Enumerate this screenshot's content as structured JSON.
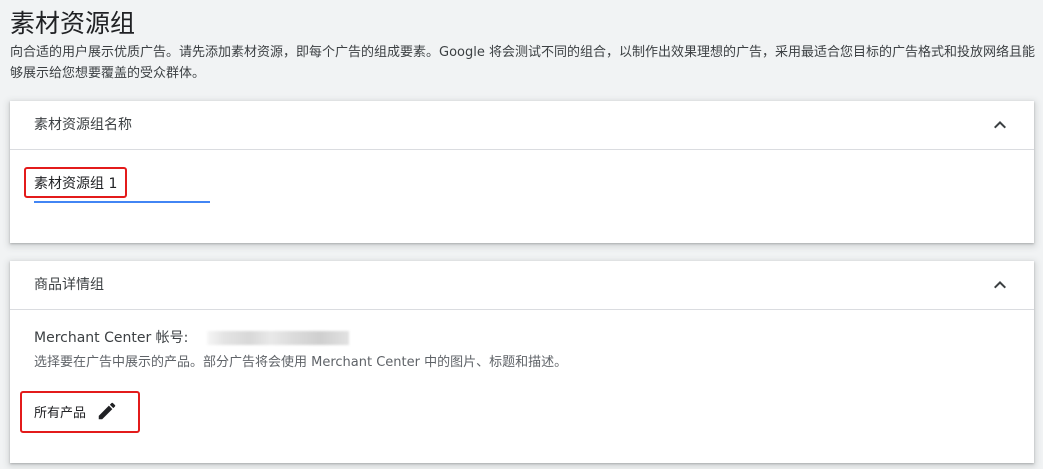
{
  "page": {
    "title": "素材资源组",
    "description": "向合适的用户展示优质广告。请先添加素材资源，即每个广告的组成要素。Google 将会测试不同的组合，以制作出效果理想的广告，采用最适合您目标的广告格式和投放网络且能够展示给您想要覆盖的受众群体。"
  },
  "asset_group_name_card": {
    "title": "素材资源组名称",
    "collapse_icon": "chevron-up-icon",
    "name_value": "素材资源组 1"
  },
  "listing_group_card": {
    "title": "商品详情组",
    "collapse_icon": "chevron-up-icon",
    "merchant_label": "Merchant Center 帐号:",
    "help_text": "选择要在广告中展示的产品。部分广告将会使用 Merchant Center 中的图片、标题和描述。",
    "products_label": "所有产品",
    "edit_icon": "pencil-icon"
  },
  "colors": {
    "accent_underline": "#4285f4",
    "highlight_box": "#e31b1b"
  }
}
